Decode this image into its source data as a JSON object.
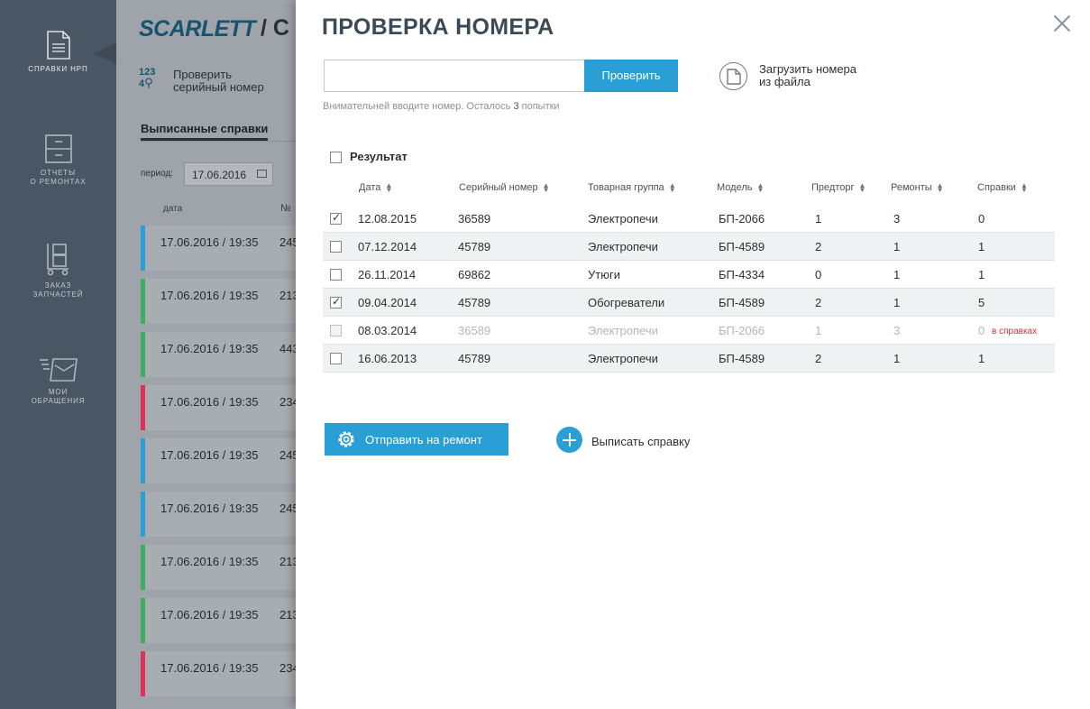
{
  "nav": {
    "items": [
      {
        "label_line1": "Справки НРП",
        "label_line2": "",
        "icon": "document-icon"
      },
      {
        "label_line1": "Отчеты",
        "label_line2": "о ремонтах",
        "icon": "cabinet-icon"
      },
      {
        "label_line1": "Заказ",
        "label_line2": "запчастей",
        "icon": "cart-icon"
      },
      {
        "label_line1": "Мои",
        "label_line2": "обращения",
        "icon": "inbox-icon"
      }
    ]
  },
  "background": {
    "logo": "SCARLETT",
    "logo_suffix": "/ С",
    "check_numbers": "123",
    "check_numbers2": "4",
    "check_label_line1": "Проверить",
    "check_label_line2": "серийный номер",
    "tab_active": "Выписанные справки",
    "period_label": "период:",
    "period_value": "17.06.2016",
    "col_date": "дата",
    "col_num": "№",
    "rows": [
      {
        "datetime": "17.06.2016 / 19:35",
        "num": "245",
        "color": "#2a9fd6"
      },
      {
        "datetime": "17.06.2016 / 19:35",
        "num": "213",
        "color": "#3fae5f"
      },
      {
        "datetime": "17.06.2016 / 19:35",
        "num": "443",
        "color": "#3fae5f"
      },
      {
        "datetime": "17.06.2016 / 19:35",
        "num": "234",
        "color": "#e0305e"
      },
      {
        "datetime": "17.06.2016 / 19:35",
        "num": "245",
        "color": "#2a9fd6"
      },
      {
        "datetime": "17.06.2016 / 19:35",
        "num": "245",
        "color": "#2a9fd6"
      },
      {
        "datetime": "17.06.2016 / 19:35",
        "num": "213",
        "color": "#3fae5f"
      },
      {
        "datetime": "17.06.2016 / 19:35",
        "num": "213",
        "color": "#3fae5f"
      },
      {
        "datetime": "17.06.2016 / 19:35",
        "num": "234",
        "color": "#e0305e"
      }
    ]
  },
  "modal": {
    "title": "ПРОВЕРКА НОМЕРА",
    "input_value": "",
    "check_button": "Проверить",
    "hint_prefix": "Внимательней вводите номер. Осталось",
    "hint_count": "3",
    "hint_suffix": "попытки",
    "upload_line1": "Загрузить номера",
    "upload_line2": "из файла",
    "result_label": "Результат",
    "columns": [
      "Дата",
      "Серийный номер",
      "Товарная группа",
      "Модель",
      "Предторг",
      "Ремонты",
      "Справки"
    ],
    "rows": [
      {
        "checked": true,
        "disabled": false,
        "date": "12.08.2015",
        "serial": "36589",
        "group": "Электропечи",
        "model": "БП-2066",
        "pretrade": "1",
        "repairs": "3",
        "refs": "0",
        "note": ""
      },
      {
        "checked": false,
        "disabled": false,
        "date": "07.12.2014",
        "serial": "45789",
        "group": "Электропечи",
        "model": "БП-4589",
        "pretrade": "2",
        "repairs": "1",
        "refs": "1",
        "note": ""
      },
      {
        "checked": false,
        "disabled": false,
        "date": "26.11.2014",
        "serial": "69862",
        "group": "Утюги",
        "model": "БП-4334",
        "pretrade": "0",
        "repairs": "1",
        "refs": "1",
        "note": ""
      },
      {
        "checked": true,
        "disabled": false,
        "date": "09.04.2014",
        "serial": "45789",
        "group": "Обогреватели",
        "model": "БП-4589",
        "pretrade": "2",
        "repairs": "1",
        "refs": "5",
        "note": ""
      },
      {
        "checked": false,
        "disabled": true,
        "date": "08.03.2014",
        "serial": "36589",
        "group": "Электропечи",
        "model": "БП-2066",
        "pretrade": "1",
        "repairs": "3",
        "refs": "0",
        "note": "в справках"
      },
      {
        "checked": false,
        "disabled": false,
        "date": "16.06.2013",
        "serial": "45789",
        "group": "Электропечи",
        "model": "БП-4589",
        "pretrade": "2",
        "repairs": "1",
        "refs": "1",
        "note": ""
      }
    ],
    "repair_button": "Отправить на ремонт",
    "issue_button": "Выписать справку"
  },
  "colors": {
    "accent": "#2a9fd6",
    "nav_bg": "#4a5663",
    "warning": "#d8323a"
  }
}
